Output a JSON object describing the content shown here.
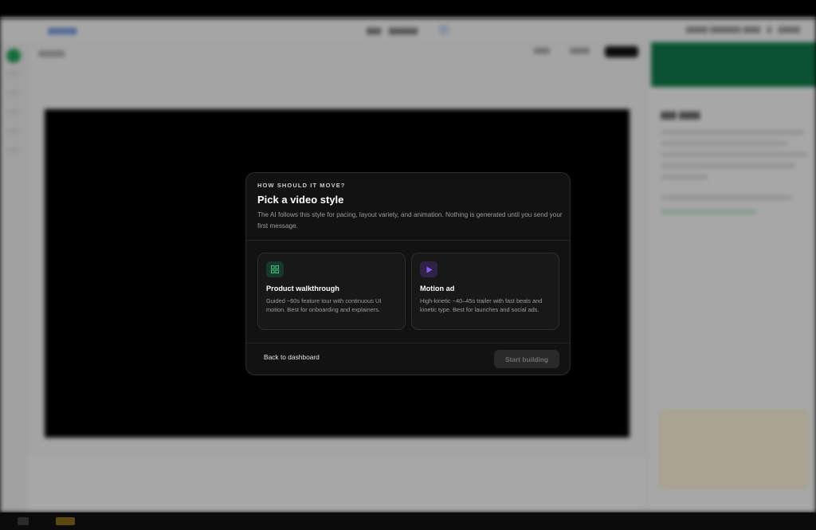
{
  "modal": {
    "eyebrow": "HOW SHOULD IT MOVE?",
    "title": "Pick a video style",
    "description": "The AI follows this style for pacing, layout variety, and animation. Nothing is generated until you send your first message.",
    "options": [
      {
        "title": "Product walkthrough",
        "description": "Guided ~60s feature tour with continuous UI motion. Best for onboarding and explainers.",
        "icon": "grid-icon",
        "accent": "#3fbf7f"
      },
      {
        "title": "Motion ad",
        "description": "High-kinetic ~40–45s trailer with fast beats and kinetic type. Best for launches and social ads.",
        "icon": "play-icon",
        "accent": "#8b5cf6"
      }
    ],
    "back_label": "Back to dashboard",
    "start_label": "Start building"
  },
  "colors": {
    "modal_bg": "#121212",
    "card_bg": "#181818",
    "brand_green": "#0f7a4a"
  }
}
